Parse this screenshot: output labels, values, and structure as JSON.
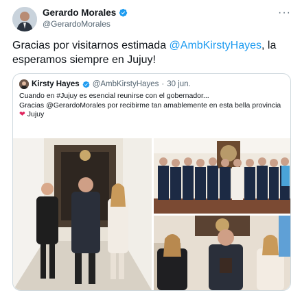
{
  "author": {
    "name": "Gerardo Morales",
    "handle": "@GerardoMorales"
  },
  "tweet": {
    "text_before": "Gracias por visitarnos estimada ",
    "mention": "@AmbKirstyHayes",
    "text_after": ", la esperamos siempre en Jujuy!"
  },
  "quote": {
    "name": "Kirsty Hayes",
    "handle": "@AmbKirstyHayes",
    "dot": "·",
    "date": "30 jun.",
    "line1": "Cuando en #Jujuy es esencial reunirse con el gobernador...",
    "line2": "Gracias @GerardoMorales por recibirme tan amablemente en esta bella provincia",
    "place_heart": "❤",
    "place": " Jujuy"
  },
  "icons": {
    "more": "more-dots-icon",
    "verified": "verified-badge-icon"
  },
  "colors": {
    "accent": "#1d9bf0",
    "text": "#0f1419",
    "muted": "#536471",
    "border": "#cfd9de",
    "heart": "#e0245e"
  }
}
